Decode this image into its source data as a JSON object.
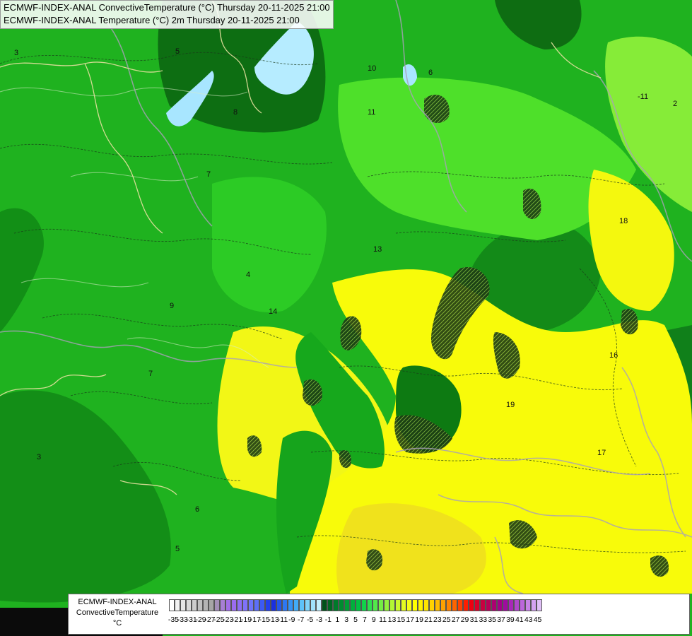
{
  "titles": {
    "line1": "ECMWF-INDEX-ANAL ConvectiveTemperature (°C) Thursday 20-11-2025 21:00",
    "line2": "ECMWF-INDEX-ANAL Temperature (°C) 2m Thursday 20-11-2025 21:00"
  },
  "legend": {
    "line1": "ECMWF-INDEX-ANAL",
    "line2": "ConvectiveTemperature",
    "unit": "°C",
    "ticks": [
      "-35",
      "-33",
      "-31",
      "-29",
      "-27",
      "-25",
      "-23",
      "-21",
      "-19",
      "-17",
      "-15",
      "-13",
      "-11",
      "-9",
      "-7",
      "-5",
      "-3",
      "-1",
      "1",
      "3",
      "5",
      "7",
      "9",
      "11",
      "13",
      "15",
      "17",
      "19",
      "21",
      "23",
      "25",
      "27",
      "29",
      "31",
      "33",
      "35",
      "37",
      "39",
      "41",
      "43",
      "45"
    ],
    "colors": [
      "#ffffff",
      "#f2f2f2",
      "#e6e6e6",
      "#d9d9d9",
      "#cccccc",
      "#bfbfbf",
      "#b3b3b3",
      "#a6a6a6",
      "#a38fb8",
      "#a77fd4",
      "#a26fe8",
      "#9a6cf0",
      "#8d6ef5",
      "#7f72f8",
      "#6e74fa",
      "#5c6ff8",
      "#3c5af5",
      "#2440ee",
      "#1a2fe0",
      "#2456ec",
      "#2e78f2",
      "#3594f6",
      "#42acf8",
      "#5ec2fa",
      "#7fd4fb",
      "#a0e2fc",
      "#c2eefd",
      "#00521a",
      "#006622",
      "#007a2a",
      "#008c30",
      "#009e36",
      "#00b03c",
      "#00c242",
      "#10d34a",
      "#2ee04e",
      "#52e84a",
      "#74ee44",
      "#94f23c",
      "#b2f634",
      "#ccf82c",
      "#e4fa22",
      "#f6fc16",
      "#ffff00",
      "#fff200",
      "#ffe400",
      "#ffd200",
      "#ffbc00",
      "#ffa200",
      "#ff8400",
      "#ff6400",
      "#ff4200",
      "#ff1e00",
      "#f00010",
      "#dc0028",
      "#c80040",
      "#b80058",
      "#ac0070",
      "#a40088",
      "#a00aa0",
      "#a828b8",
      "#b048cc",
      "#bc66dc",
      "#c884e8",
      "#d4a2f0",
      "#e0c0f6"
    ]
  },
  "contour_labels": [
    "3",
    "5",
    "7",
    "9",
    "8",
    "10",
    "11",
    "13",
    "14",
    "16",
    "17",
    "18",
    "19",
    "-11",
    "2",
    "6",
    "5",
    "7",
    "6",
    "4",
    "3"
  ]
}
